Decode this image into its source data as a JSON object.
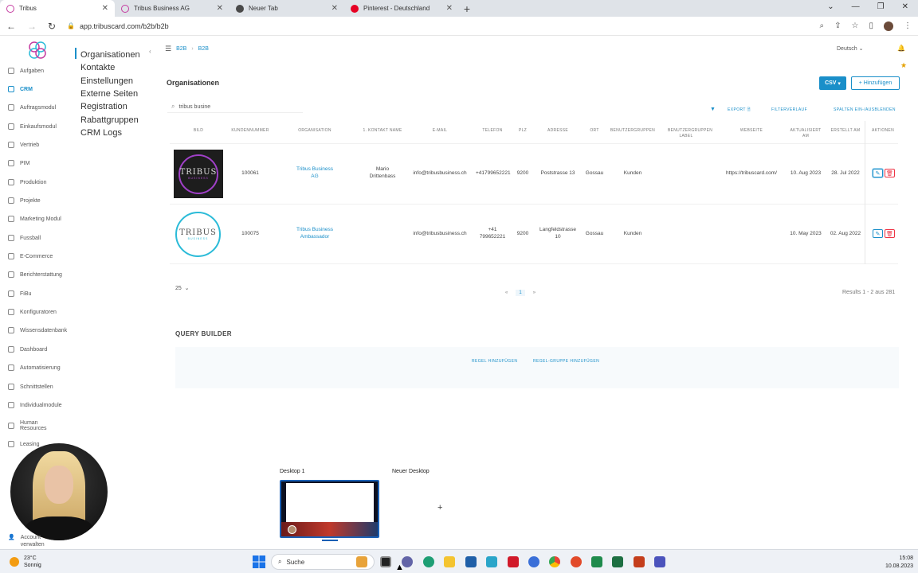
{
  "browser": {
    "tabs": [
      {
        "label": "Tribus",
        "color": "#c53ba0",
        "active": true
      },
      {
        "label": "Tribus Business AG",
        "color": "#c53ba0",
        "active": false
      },
      {
        "label": "Neuer Tab",
        "color": "#4a4a4a",
        "active": false
      },
      {
        "label": "Pinterest - Deutschland",
        "color": "#e60023",
        "active": false
      }
    ],
    "url": "app.tribuscard.com/b2b/b2b"
  },
  "sidebar": {
    "items": [
      {
        "label": "Aufgaben"
      },
      {
        "label": "CRM",
        "active": true
      },
      {
        "label": "Auftragsmodul"
      },
      {
        "label": "Einkaufsmodul"
      },
      {
        "label": "Vertrieb"
      },
      {
        "label": "PIM"
      },
      {
        "label": "Produktion"
      },
      {
        "label": "Projekte"
      },
      {
        "label": "Marketing Modul"
      },
      {
        "label": "Fussball"
      },
      {
        "label": "E-Commerce"
      },
      {
        "label": "Berichterstattung"
      },
      {
        "label": "FiBu"
      },
      {
        "label": "Konfiguratoren"
      },
      {
        "label": "Wissensdatenbank"
      },
      {
        "label": "Dashboard"
      },
      {
        "label": "Automatisierung"
      },
      {
        "label": "Schnittstellen"
      },
      {
        "label": "Individualmodule"
      },
      {
        "label": "Human Resources"
      },
      {
        "label": "Leasing"
      }
    ],
    "account_label": "Account verwalten"
  },
  "subnav": {
    "items": [
      {
        "label": "Organisationen",
        "active": true
      },
      {
        "label": "Kontakte"
      },
      {
        "label": "Einstellungen"
      },
      {
        "label": "Externe Seiten"
      },
      {
        "label": "Registration"
      },
      {
        "label": "Rabattgruppen"
      },
      {
        "label": "CRM Logs"
      }
    ]
  },
  "header": {
    "breadcrumb": [
      "B2B",
      "B2B"
    ],
    "language": "Deutsch"
  },
  "main": {
    "title": "Organisationen",
    "csv_label": "CSV",
    "add_label": "+ Hinzufügen",
    "search_value": "tribus busine",
    "toolbar": {
      "export": "EXPORT",
      "filter_history": "FILTERVERLAUF",
      "columns": "SPALTEN EIN-/AUSBLENDEN"
    },
    "columns": [
      "BILD",
      "KUNDENNUMMER",
      "ORGANISATION",
      "1. KONTAKT NAME",
      "E-MAIL",
      "TELEFON",
      "PLZ",
      "ADRESSE",
      "ORT",
      "BENUTZERGRUPPEN",
      "BENUTZERGRUPPEN LABEL",
      "WEBSEITE",
      "AKTUALISIERT AM",
      "ERSTELLT AM",
      "AKTIONEN"
    ],
    "rows": [
      {
        "logo_text": "TRIBUS",
        "logo_sub": "BUSINESS",
        "customer_no": "100061",
        "organisation": "Tribus Business AG",
        "contact": "Mario Drittenbass",
        "email": "info@tribusbusiness.ch",
        "phone": "+41799652221",
        "zip": "9200",
        "address": "Poststrasse 13",
        "city": "Gossau",
        "user_groups": "Kunden",
        "website": "https://tribuscard.com/",
        "updated": "10. Aug 2023",
        "created": "28. Jul 2022"
      },
      {
        "logo_text": "TRIBUS",
        "logo_sub": "BUSINESS",
        "customer_no": "100075",
        "organisation": "Tribus Business Ambassador",
        "contact": "",
        "email": "info@tribusbusiness.ch",
        "phone": "+41 799652221",
        "zip": "9200",
        "address": "Langfeldstrasse 10",
        "city": "Gossau",
        "user_groups": "Kunden",
        "website": "",
        "updated": "10. May 2023",
        "created": "02. Aug 2022"
      }
    ],
    "page_size": "25",
    "current_page": "1",
    "results": "Results 1 - 2 aus 281"
  },
  "query_builder": {
    "title": "QUERY BUILDER",
    "add_rule": "REGEL HINZUFÜGEN",
    "add_group": "REGEL-GRUPPE HINZUFÜGEN"
  },
  "task_view": {
    "desktop1": "Desktop 1",
    "new_desktop": "Neuer Desktop"
  },
  "taskbar": {
    "temperature": "23°C",
    "weather": "Sonnig",
    "search_placeholder": "Suche",
    "time": "15:08",
    "date": "10.08.2023"
  }
}
